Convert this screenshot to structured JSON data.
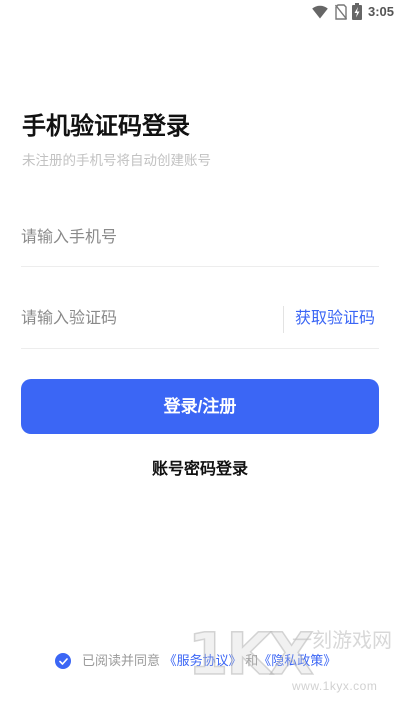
{
  "status_bar": {
    "time": "3:05",
    "icons": [
      "wifi-icon",
      "no-sim-icon",
      "battery-charging-icon"
    ]
  },
  "login": {
    "title": "手机验证码登录",
    "subtitle": "未注册的手机号将自动创建账号",
    "phone_value": "",
    "phone_placeholder": "请输入手机号",
    "code_value": "",
    "code_placeholder": "请输入验证码",
    "get_code_label": "获取验证码",
    "submit_label": "登录/注册",
    "password_login_label": "账号密码登录"
  },
  "agreement": {
    "checked": true,
    "prefix": "已阅读并同意",
    "service_link": "《服务协议》",
    "conjunction": "和",
    "privacy_link": "《隐私政策》"
  },
  "watermark": {
    "logo": "1KX",
    "site_name": "一刻游戏网",
    "url": "www.1kyx.com"
  },
  "colors": {
    "accent": "#3b66f5",
    "text": "#111111",
    "muted": "#c2c2c2"
  }
}
